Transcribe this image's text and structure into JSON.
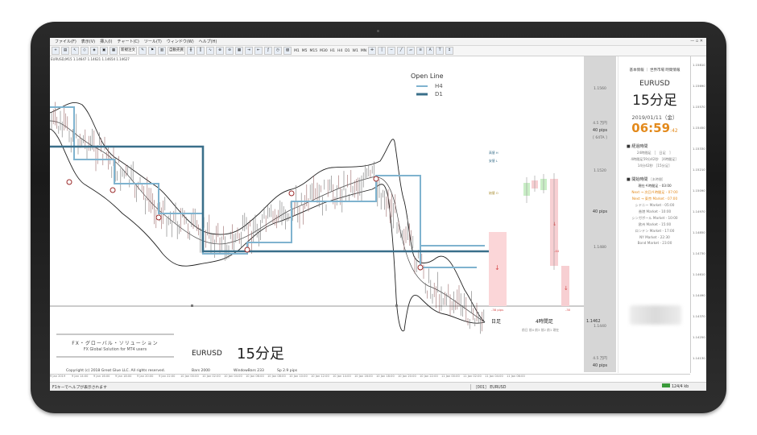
{
  "menubar": {
    "items": [
      "ファイル(F)",
      "表示(V)",
      "挿入(I)",
      "チャート(C)",
      "ツール(T)",
      "ウィンドウ(W)",
      "ヘルプ(H)"
    ]
  },
  "toolbar": {
    "new_order": "新規注文",
    "auto_trade": "自動売買",
    "timeframes": [
      "M1",
      "M5",
      "M15",
      "M30",
      "H1",
      "H4",
      "D1",
      "W1",
      "MN"
    ]
  },
  "chart": {
    "symbol_line": "EURUSD,M15  1.14647 1.14621 1.14654 1.14627",
    "open_line_title": "Open Line",
    "legend": [
      {
        "label": "H4",
        "color": "#7fb3cf"
      },
      {
        "label": "D1",
        "color": "#3a6f8a"
      }
    ],
    "price_line_label": "1.1462",
    "day_label": "日足",
    "h4_label": "4時間足",
    "mid_marks": [
      "高値 H",
      "安値 L",
      "始値 O"
    ],
    "bar_pips_1": "-38 pips",
    "bar_pips_2": "-44",
    "bar_pips_3": "-30",
    "small_cols": [
      "前日",
      "前4",
      "前3",
      "前2",
      "前1",
      "現在"
    ]
  },
  "panel": {
    "price_1": "1.1560",
    "pips_1": "4.5 万円",
    "pips_1b": "40 pips",
    "atr": "[ 64TA ]",
    "price_2": "1.1520",
    "pips_2": "40 pips",
    "price_3": "1.1480",
    "price_4": "1.1440",
    "pips_3": "4.5 万円",
    "pips_3b": "40 pips"
  },
  "info": {
    "tabs": "基本情報 ｜ 世界市場 時間情報",
    "symbol": "EURUSD",
    "timeframe": "15分足",
    "date": "2019/01/11（金）",
    "clock": "06:59",
    "clock_sec": ":42",
    "section_elapsed": "■ 経過時間",
    "elapsed_rows": [
      "24時間足 ［　日足　］",
      "4時間足59分42秒 ［4時間足］",
      "14分42秒 ［15分足］"
    ],
    "section_open": "■ 開始時間",
    "open_note": "［本時間］",
    "open_rows": [
      {
        "text": "現在４時間足 - 03:00",
        "style": "bl"
      },
      {
        "text": "Next → 次回４時間足 - 07:00",
        "style": "hl"
      },
      {
        "text": "Next → 東京 Market - 07:00",
        "style": "hl"
      },
      {
        "text": "シドニー Market - 05:00",
        "style": ""
      },
      {
        "text": "香港 Market - 10:00",
        "style": ""
      },
      {
        "text": "シンガポール Market - 10:00",
        "style": ""
      },
      {
        "text": "欧州 Market - 15:00",
        "style": ""
      },
      {
        "text": "ロンドン Market - 17:00",
        "style": ""
      },
      {
        "text": "NY Market - 22:30",
        "style": ""
      },
      {
        "text": "Bond Market - 23:00",
        "style": ""
      }
    ]
  },
  "price_axis": [
    "1.15810",
    "1.15690",
    "1.15570",
    "1.15450",
    "1.15330",
    "1.15210",
    "1.15090",
    "1.14970",
    "1.14850",
    "1.14730",
    "1.14610",
    "1.14490",
    "1.14370",
    "1.14250",
    "1.14130"
  ],
  "brand": {
    "jp": "FX・グローバル・ソリューション",
    "en": "FX Global Solution for MT4 users",
    "symbol": "EURUSD",
    "timeframe": "15分足",
    "copyright": "Copyright (c) 2018  Great Glue LLC.  All rights reserved.",
    "bars": "Bars  2000",
    "window_bars": "WindowBars  233",
    "spread": "Sp  2.9 pips"
  },
  "time_axis": [
    "9 Jan 2019",
    "9 Jan 14:00",
    "9 Jan 16:00",
    "9 Jan 18:00",
    "9 Jan 20:00",
    "9 Jan 22:00",
    "10 Jan 00:00",
    "10 Jan 02:00",
    "10 Jan 04:00",
    "10 Jan 06:00",
    "10 Jan 08:00",
    "10 Jan 10:00",
    "10 Jan 12:00",
    "10 Jan 14:00",
    "10 Jan 16:00",
    "10 Jan 18:00",
    "10 Jan 20:00",
    "10 Jan 22:00",
    "11 Jan 00:00",
    "11 Jan 02:00",
    "11 Jan 04:00",
    "11 Jan 06:00"
  ],
  "statusbar": {
    "help": "F1キーでヘルプが表示されます",
    "profile": "［001］ EURUSD",
    "traffic": "124/4 kb"
  }
}
